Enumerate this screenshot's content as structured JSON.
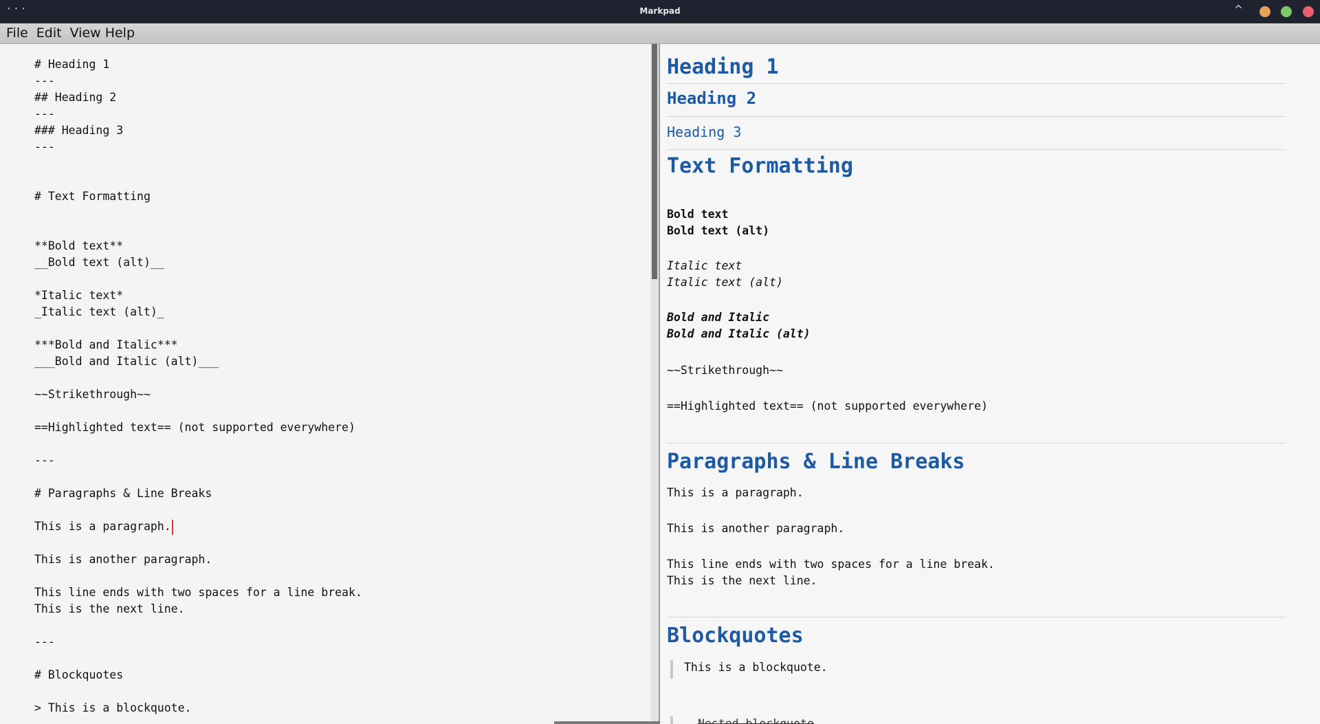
{
  "window": {
    "title": "Markpad",
    "dots": "···",
    "chevron": "^"
  },
  "menu": [
    "File",
    "Edit",
    "View",
    "Help"
  ],
  "editor": {
    "lines": [
      "# Heading 1",
      "---",
      "## Heading 2",
      "---",
      "### Heading 3",
      "---",
      "",
      "",
      "# Text Formatting",
      "",
      "",
      "**Bold text**",
      "__Bold text (alt)__",
      "",
      "*Italic text*",
      "_Italic text (alt)_",
      "",
      "***Bold and Italic***",
      "___Bold and Italic (alt)___",
      "",
      "~~Strikethrough~~",
      "",
      "==Highlighted text== (not supported everywhere)",
      "",
      "---",
      "",
      "# Paragraphs & Line Breaks",
      "",
      "This is a paragraph.",
      "",
      "This is another paragraph.",
      "",
      "This line ends with two spaces for a line break.",
      "This is the next line.",
      "",
      "---",
      "",
      "# Blockquotes",
      "",
      "> This is a blockquote."
    ]
  },
  "preview": {
    "h1": "Heading 1",
    "h2": "Heading 2",
    "h3": "Heading 3",
    "text_formatting": "Text Formatting",
    "bold": "Bold text",
    "bold_alt": "Bold text (alt)",
    "italic": "Italic text",
    "italic_alt": "Italic text (alt)",
    "bold_italic": "Bold and Italic",
    "bold_italic_alt": "Bold and Italic (alt)",
    "strike": "~~Strikethrough~~",
    "highlight": "==Highlighted text== (not supported everywhere)",
    "paragraphs_heading": "Paragraphs & Line Breaks",
    "para1": "This is a paragraph.",
    "para2": "This is another paragraph.",
    "para3a": "This line ends with two spaces for a line break.",
    "para3b": "This is the next line.",
    "blockquotes_heading": "Blockquotes",
    "blockquote1": "This is a blockquote.",
    "nested_partial": "Nested blockquote"
  }
}
